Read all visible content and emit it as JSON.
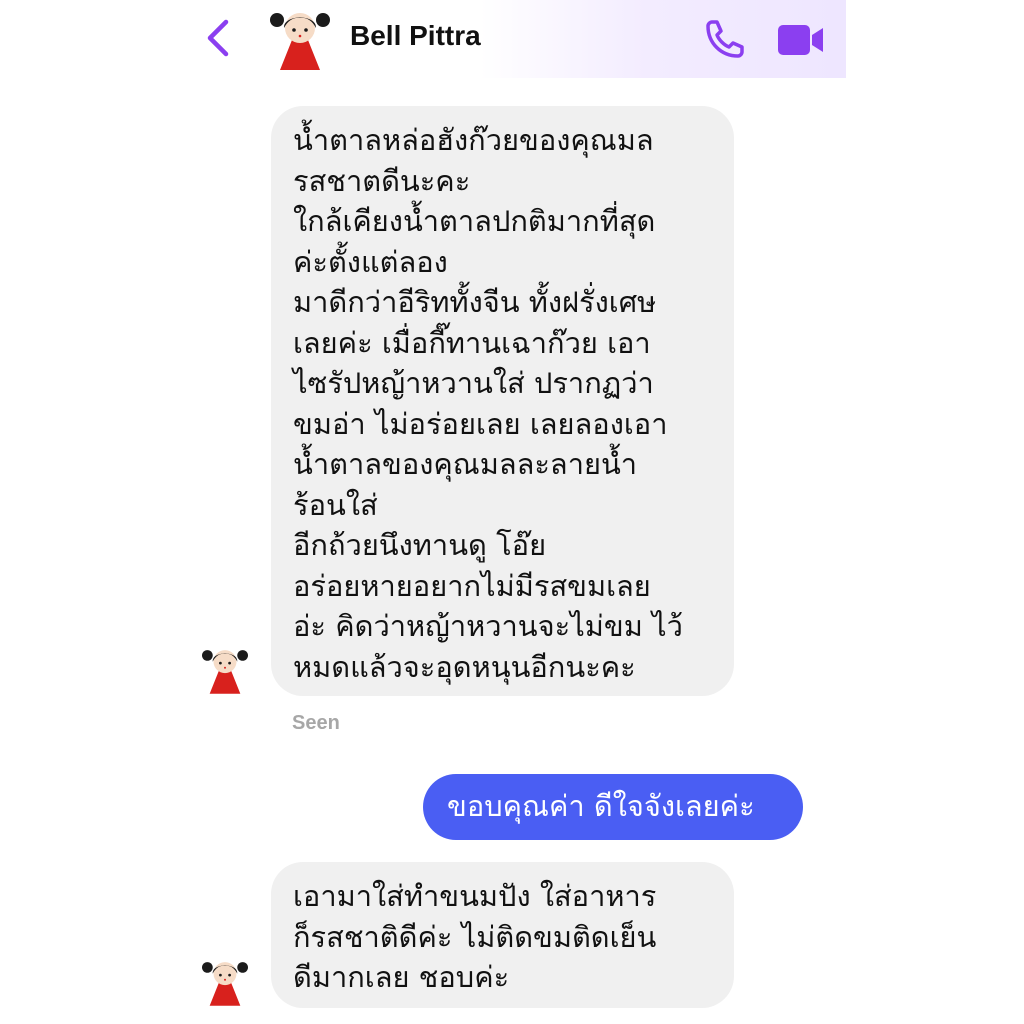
{
  "header": {
    "contact_name": "Bell Pittra",
    "icons": {
      "back": "chevron-left-icon",
      "call": "phone-icon",
      "video": "video-camera-icon"
    },
    "accent_color": "#8b3ff0"
  },
  "messages": [
    {
      "direction": "incoming",
      "lines": [
        "น้ำตาลหล่อฮังก๊วยของคุณมล",
        "รสชาตดีนะคะ",
        "ใกล้เคียงน้ำตาลปกติมากที่สุด",
        "ค่ะตั้งแต่ลอง",
        "มาดีกว่าอีริททั้งจีน ทั้งฝรั่งเศษ",
        "เลยค่ะ  เมื่อกี๊ทานเฉาก๊วย  เอา",
        "ไซรัปหญ้าหวานใส่ ปรากฏว่า",
        "ขมอ่า ไม่อร่อยเลย  เลยลองเอา",
        "น้ำตาลของคุณมลละลายน้ำ",
        "ร้อนใส่",
        "อีกถ้วยนึงทานดู  โอ๊ย",
        "อร่อยหายอยากไม่มีรสขมเลย",
        "อ่ะ  คิดว่าหญ้าหวานจะไม่ขม ไว้",
        "หมดแล้วจะอุดหนุนอีกนะคะ"
      ]
    },
    {
      "direction": "outgoing",
      "text": "ขอบคุณค่า ดีใจจังเลยค่ะ"
    },
    {
      "direction": "incoming",
      "lines": [
        "เอามาใส่ทำขนมปัง  ใส่อาหาร",
        "ก็รสชาติดีค่ะ  ไม่ติดขมติดเย็น",
        "ดีมากเลย ชอบค่ะ"
      ]
    }
  ],
  "seen_label": "Seen",
  "colors": {
    "incoming_bubble": "#f0f0f0",
    "outgoing_bubble": "#4a5ef3",
    "seen_text": "#a7a7a7"
  }
}
